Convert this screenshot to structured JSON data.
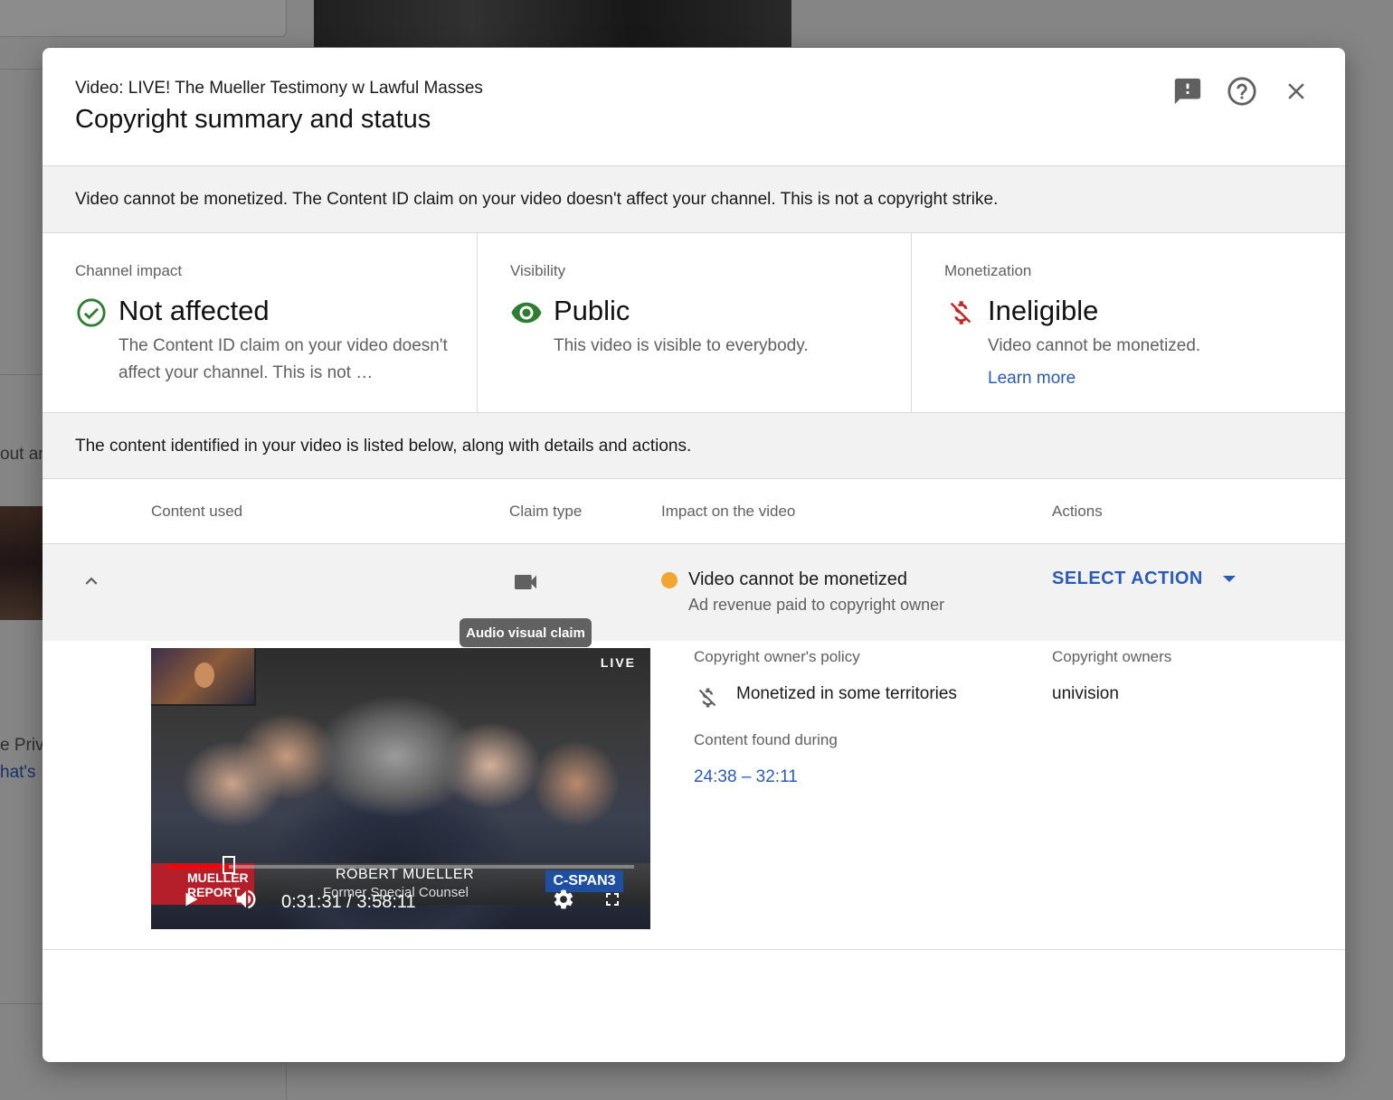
{
  "background": {
    "snippet1": "out an",
    "snippet2": "e Priv",
    "snippet3": "hat's"
  },
  "dialog": {
    "subtitle": "Video: LIVE! The Mueller Testimony w Lawful Masses",
    "title": "Copyright summary and status",
    "header_icons": [
      "feedback-icon",
      "help-icon",
      "close-icon"
    ]
  },
  "banner": {
    "text": "Video cannot be monetized. The Content ID claim on your video doesn't affect your channel. This is not a copyright strike."
  },
  "cards": {
    "channel_impact": {
      "label": "Channel impact",
      "value": "Not affected",
      "description": "The Content ID claim on your video doesn't affect your channel. This is not …",
      "icon": "check-circle-icon",
      "color": "#2e7d32"
    },
    "visibility": {
      "label": "Visibility",
      "value": "Public",
      "description": "This video is visible to everybody.",
      "icon": "eye-icon",
      "color": "#2e7d32"
    },
    "monetization": {
      "label": "Monetization",
      "value": "Ineligible",
      "description": "Video cannot be monetized.",
      "link": "Learn more",
      "icon": "no-money-icon",
      "color": "#c62828"
    }
  },
  "info_bar": {
    "text": "The content identified in your video is listed below, along with details and actions."
  },
  "table": {
    "headers": {
      "content_used": "Content used",
      "claim_type": "Claim type",
      "impact": "Impact on the video",
      "actions": "Actions"
    },
    "row": {
      "claim_icon": "video-camera-icon",
      "tooltip": "Audio visual claim",
      "impact_main": "Video cannot be monetized",
      "impact_sub": "Ad revenue paid to copyright owner",
      "status_color": "#f2a532",
      "action_label": "SELECT ACTION"
    }
  },
  "details": {
    "video": {
      "live_badge": "LIVE",
      "chyron_tag": "MUELLER REPORT",
      "chyron_name": "ROBERT MUELLER",
      "chyron_title": "Former Special Counsel",
      "network": "C-SPAN3",
      "time_display": "0:31:31 / 3:58:11",
      "progress": 0.132
    },
    "policy_label": "Copyright owner's policy",
    "policy_value": "Monetized in some territories",
    "owners_label": "Copyright owners",
    "owners_value": "univision",
    "found_label": "Content found during",
    "found_range": "24:38 – 32:11"
  },
  "colors": {
    "link": "#2a5bb8",
    "accent_red": "#ff0000"
  }
}
